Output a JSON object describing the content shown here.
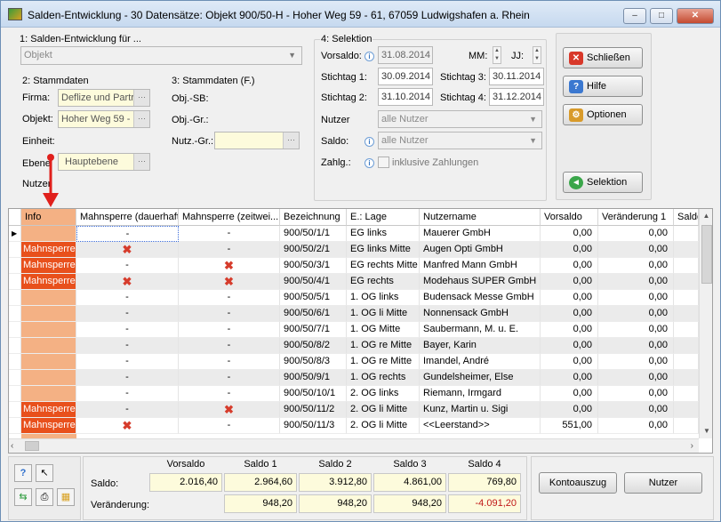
{
  "window": {
    "title": "Salden-Entwicklung - 30 Datensätze:  Objekt 900/50-H - Hoher Weg 59 - 61, 67059 Ludwigshafen a. Rhein",
    "min_glyph": "–",
    "max_glyph": "□",
    "close_glyph": "✕"
  },
  "section1": {
    "label": "1: Salden-Entwicklung für ...",
    "select_value": "Objekt"
  },
  "section2": {
    "label": "2: Stammdaten",
    "firma_label": "Firma:",
    "firma_value": "Deflize und Partr",
    "objekt_label": "Objekt:",
    "objekt_value": "Hoher Weg 59 -",
    "einheit_label": "Einheit:",
    "ebene_label": "Ebene",
    "ebene_value": "Hauptebene",
    "nutzer_label": "Nutzer"
  },
  "section3": {
    "label": "3: Stammdaten (F.)",
    "objsb_label": "Obj.-SB:",
    "objgr_label": "Obj.-Gr.:",
    "nutzgr_label": "Nutz.-Gr.:"
  },
  "section4": {
    "label": "4: Selektion",
    "vorsaldo_label": "Vorsaldo:",
    "vorsaldo_value": "31.08.2014",
    "mm_label": "MM:",
    "jj_label": "JJ:",
    "stichtag1_label": "Stichtag 1:",
    "stichtag1_value": "30.09.2014",
    "stichtag2_label": "Stichtag 2:",
    "stichtag2_value": "31.10.2014",
    "stichtag3_label": "Stichtag 3:",
    "stichtag3_value": "30.11.2014",
    "stichtag4_label": "Stichtag 4:",
    "stichtag4_value": "31.12.2014",
    "nutzer_label": "Nutzer",
    "nutzer_value": "alle Nutzer",
    "saldo_label": "Saldo:",
    "saldo_value": "alle Nutzer",
    "zahlg_label": "Zahlg.:",
    "zahlg_checkbox_label": "inklusive Zahlungen"
  },
  "buttons": {
    "schliessen": "Schließen",
    "hilfe": "Hilfe",
    "optionen": "Optionen",
    "selektion": "Selektion",
    "kontoauszug": "Kontoauszug",
    "nutzer": "Nutzer"
  },
  "table": {
    "headers": [
      "Info",
      "Mahnsperre (dauerhaft)",
      "Mahnsperre (zeitwei...",
      "Bezeichnung",
      "E.: Lage",
      "Nutzername",
      "Vorsaldo",
      "Veränderung 1",
      "Saldo"
    ],
    "rows": [
      {
        "info": "",
        "md": "-",
        "mz": "-",
        "bez": "900/50/1/1",
        "lage": "EG links",
        "name": "Mauerer GmbH",
        "vorsaldo": "0,00",
        "ver1": "0,00"
      },
      {
        "info": "Mahnsperre",
        "md": "x",
        "mz": "-",
        "bez": "900/50/2/1",
        "lage": "EG links Mitte",
        "name": "Augen Opti GmbH",
        "vorsaldo": "0,00",
        "ver1": "0,00"
      },
      {
        "info": "Mahnsperre",
        "md": "-",
        "mz": "x",
        "bez": "900/50/3/1",
        "lage": "EG rechts Mitte",
        "name": "Manfred Mann GmbH",
        "vorsaldo": "0,00",
        "ver1": "0,00"
      },
      {
        "info": "Mahnsperre",
        "md": "x",
        "mz": "x",
        "bez": "900/50/4/1",
        "lage": "EG rechts",
        "name": "Modehaus SUPER GmbH",
        "vorsaldo": "0,00",
        "ver1": "0,00"
      },
      {
        "info": "",
        "md": "-",
        "mz": "-",
        "bez": "900/50/5/1",
        "lage": "1. OG links",
        "name": "Budensack Messe GmbH",
        "vorsaldo": "0,00",
        "ver1": "0,00"
      },
      {
        "info": "",
        "md": "-",
        "mz": "-",
        "bez": "900/50/6/1",
        "lage": "1. OG li Mitte",
        "name": "Nonnensack GmbH",
        "vorsaldo": "0,00",
        "ver1": "0,00"
      },
      {
        "info": "",
        "md": "-",
        "mz": "-",
        "bez": "900/50/7/1",
        "lage": "1. OG Mitte",
        "name": "Saubermann, M. u. E.",
        "vorsaldo": "0,00",
        "ver1": "0,00"
      },
      {
        "info": "",
        "md": "-",
        "mz": "-",
        "bez": "900/50/8/2",
        "lage": "1. OG re Mitte",
        "name": "Bayer, Karin",
        "vorsaldo": "0,00",
        "ver1": "0,00"
      },
      {
        "info": "",
        "md": "-",
        "mz": "-",
        "bez": "900/50/8/3",
        "lage": "1. OG re Mitte",
        "name": "Imandel, André",
        "vorsaldo": "0,00",
        "ver1": "0,00"
      },
      {
        "info": "",
        "md": "-",
        "mz": "-",
        "bez": "900/50/9/1",
        "lage": "1. OG rechts",
        "name": "Gundelsheimer, Else",
        "vorsaldo": "0,00",
        "ver1": "0,00"
      },
      {
        "info": "",
        "md": "-",
        "mz": "-",
        "bez": "900/50/10/1",
        "lage": "2. OG links",
        "name": "Riemann, Irmgard",
        "vorsaldo": "0,00",
        "ver1": "0,00"
      },
      {
        "info": "Mahnsperre",
        "md": "-",
        "mz": "x",
        "bez": "900/50/11/2",
        "lage": "2. OG li Mitte",
        "name": "Kunz, Martin u. Sigi",
        "vorsaldo": "0,00",
        "ver1": "0,00"
      },
      {
        "info": "Mahnsperre",
        "md": "x",
        "mz": "-",
        "bez": "900/50/11/3",
        "lage": "2. OG li Mitte",
        "name": "<<Leerstand>>",
        "vorsaldo": "551,00",
        "ver1": "0,00"
      }
    ]
  },
  "summary": {
    "headers": [
      "Vorsaldo",
      "Saldo 1",
      "Saldo 2",
      "Saldo 3",
      "Saldo 4"
    ],
    "saldo_label": "Saldo:",
    "saldo_values": [
      "2.016,40",
      "2.964,60",
      "3.912,80",
      "4.861,00",
      "769,80"
    ],
    "veraenderung_label": "Veränderung:",
    "veraenderung_values": [
      "948,20",
      "948,20",
      "948,20",
      "-4.091,20"
    ]
  },
  "colors": {
    "mahnsperre_bg": "#e8501c",
    "info_column_bg": "#f4b184",
    "field_yellow": "#fdfbdc",
    "negative_text": "#c01818",
    "annotation_arrow": "#e0201c"
  },
  "icons": [
    "app-icon",
    "close-x-icon",
    "help-question-icon",
    "options-gear-icon",
    "selection-arrow-icon",
    "cursor-icon",
    "refresh-icon",
    "print-icon",
    "export-icon"
  ]
}
